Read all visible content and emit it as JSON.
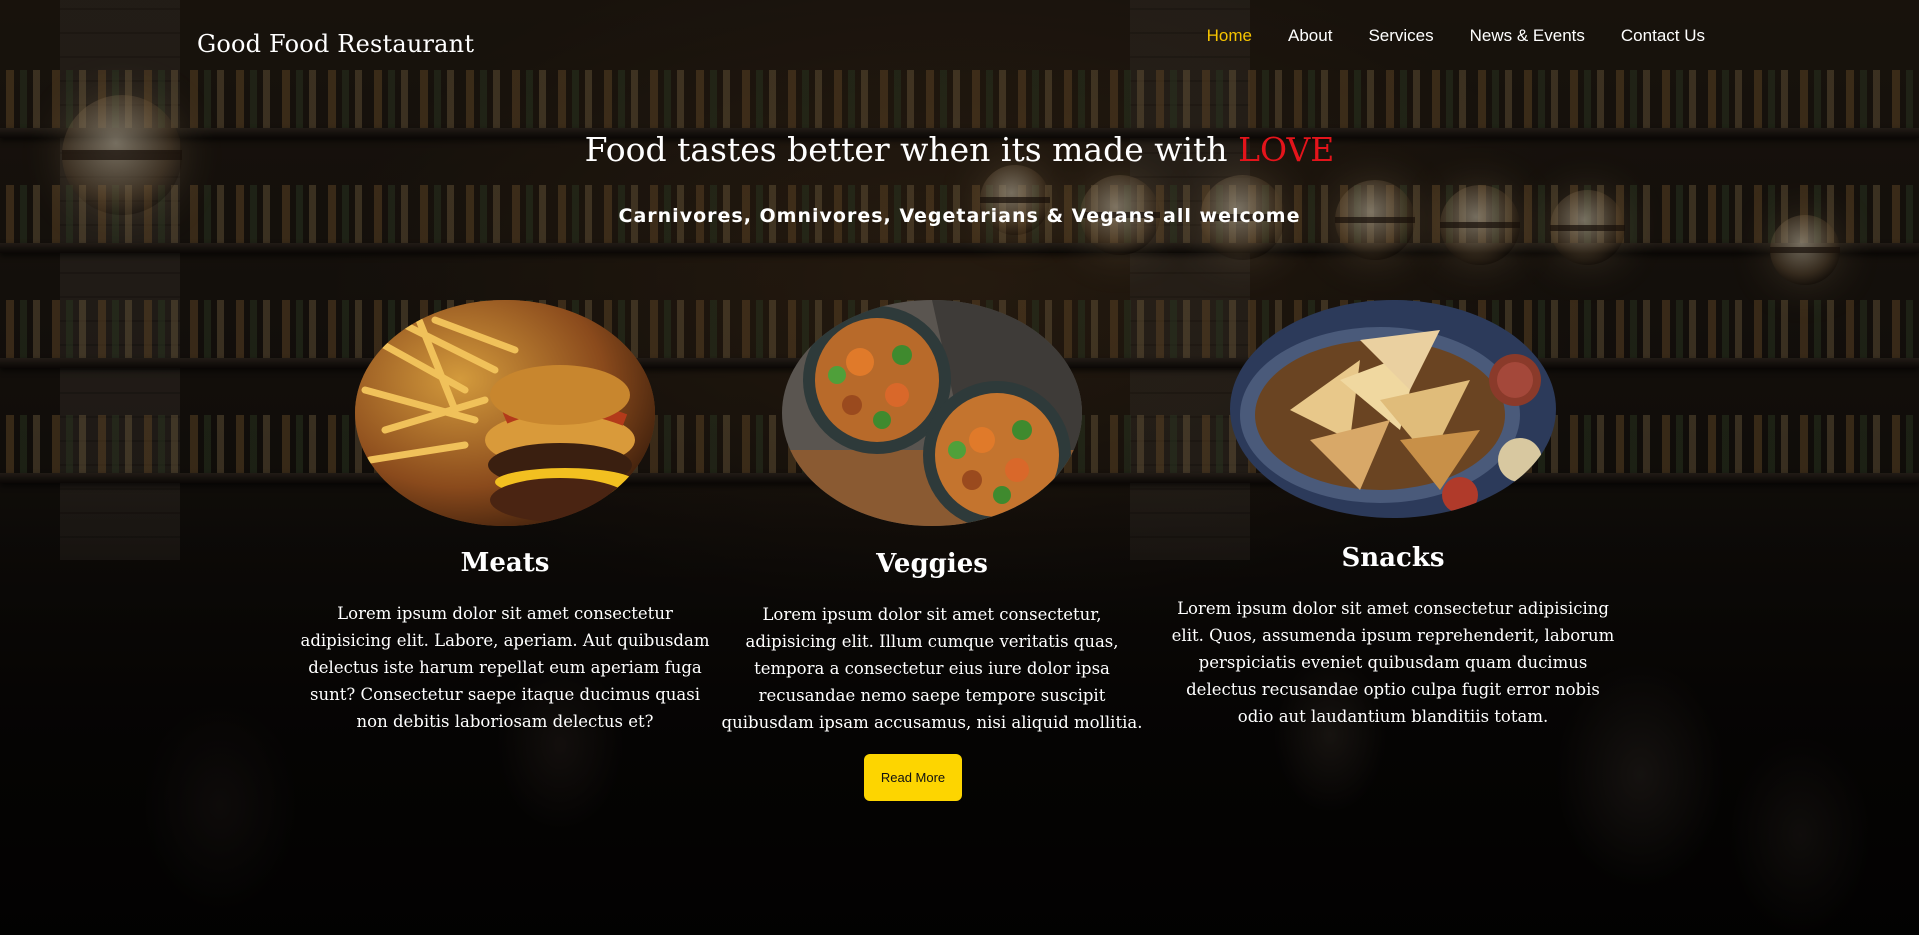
{
  "site": {
    "brand": "Good Food Restaurant"
  },
  "nav": {
    "items": [
      {
        "label": "Home",
        "active": true
      },
      {
        "label": "About",
        "active": false
      },
      {
        "label": "Services",
        "active": false
      },
      {
        "label": "News & Events",
        "active": false
      },
      {
        "label": "Contact Us",
        "active": false
      }
    ],
    "active_color": "#f6c400"
  },
  "hero": {
    "title_prefix": "Food tastes better when its made with ",
    "title_highlight": "LOVE",
    "highlight_color": "#e4141b",
    "subtitle": "Carnivores, Omnivores, Vegetarians & Vegans all welcome"
  },
  "cards": [
    {
      "image_icon": "burger-fries-image",
      "title": "Meats",
      "text": "Lorem ipsum dolor sit amet consectetur adipisicing elit. Labore, aperiam. Aut quibusdam delectus iste harum repellat eum aperiam fuga sunt? Consectetur saepe itaque ducimus quasi non debitis laboriosam delectus et?"
    },
    {
      "image_icon": "veggie-bowls-image",
      "title": "Veggies",
      "text": "Lorem ipsum dolor sit amet consectetur, adipisicing elit. Illum cumque veritatis quas, tempora a consectetur eius iure dolor ipsa recusandae nemo saepe tempore suscipit quibusdam ipsam accusamus, nisi aliquid mollitia."
    },
    {
      "image_icon": "nachos-snack-image",
      "title": "Snacks",
      "text": "Lorem ipsum dolor sit amet consectetur adipisicing elit. Quos, assumenda ipsum reprehenderit, laborum perspiciatis eveniet quibusdam quam ducimus delectus recusandae optio culpa fugit error nobis odio aut laudantium blanditiis totam."
    }
  ],
  "cta": {
    "label": "Read More",
    "color": "#fdd500"
  }
}
